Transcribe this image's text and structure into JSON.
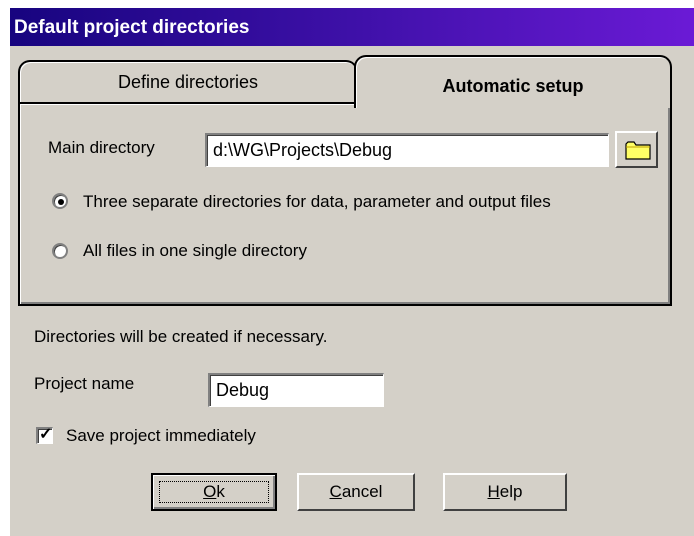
{
  "window": {
    "title": "Default project directories"
  },
  "tabs": [
    {
      "label": "Define directories",
      "active": false
    },
    {
      "label": "Automatic setup",
      "active": true
    }
  ],
  "main_directory": {
    "label": "Main directory",
    "value": "d:\\WG\\Projects\\Debug",
    "browse_icon": "folder-icon"
  },
  "layout_options": [
    {
      "label": "Three separate directories for data, parameter and output files",
      "selected": true
    },
    {
      "label": "All files in one single directory",
      "selected": false
    }
  ],
  "info_text": "Directories will be created if necessary.",
  "project_name": {
    "label": "Project name",
    "value": "Debug"
  },
  "save_immediately": {
    "label": "Save project immediately",
    "checked": true
  },
  "buttons": {
    "ok": {
      "mnemonic": "O",
      "rest": "k"
    },
    "cancel": {
      "mnemonic": "C",
      "rest": "ancel"
    },
    "help": {
      "mnemonic": "H",
      "rest": "elp"
    }
  },
  "colors": {
    "titlebar_start": "#17047f",
    "titlebar_end": "#6b1ad6",
    "dialog_bg": "#d4d0c8"
  }
}
